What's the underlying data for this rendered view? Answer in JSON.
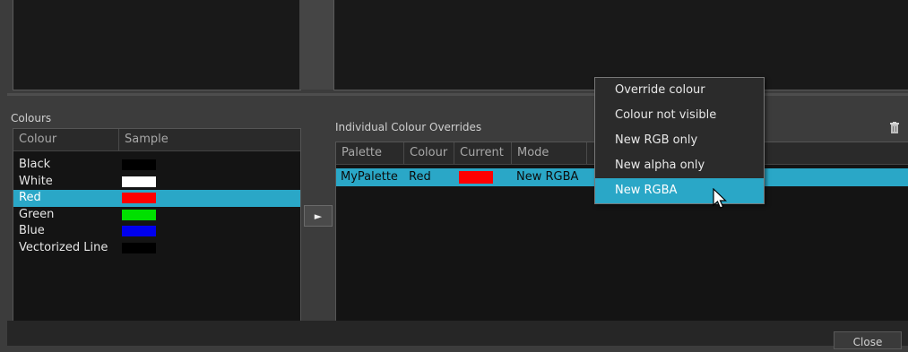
{
  "colours_panel": {
    "label": "Colours",
    "columns": [
      "Colour",
      "Sample"
    ],
    "rows": [
      {
        "name": "Black",
        "sample": "#000000",
        "selected": false
      },
      {
        "name": "White",
        "sample": "#ffffff",
        "selected": false
      },
      {
        "name": "Red",
        "sample": "#ff0000",
        "selected": true
      },
      {
        "name": "Green",
        "sample": "#00e000",
        "selected": false
      },
      {
        "name": "Blue",
        "sample": "#0000ee",
        "selected": false
      },
      {
        "name": "Vectorized Line",
        "sample": "#000000",
        "selected": false
      }
    ]
  },
  "apply_arrow": {
    "glyph": "►",
    "icon": "right-arrow-icon"
  },
  "overrides_panel": {
    "label": "Individual Colour Overrides",
    "columns": [
      "Palette",
      "Colour",
      "Current",
      "Mode"
    ],
    "rows": [
      {
        "palette": "MyPalette",
        "colour": "Red",
        "current": "#ff0000",
        "mode": "New RGBA"
      }
    ],
    "delete_icon": "trash-icon"
  },
  "mode_menu": {
    "items": [
      "Override colour",
      "Colour not visible",
      "New RGB only",
      "New alpha only",
      "New RGBA"
    ],
    "active_index": 4
  },
  "footer": {
    "close_label": "Close"
  },
  "colors": {
    "selection": "#2aa7c7",
    "panel": "#141414",
    "background": "#3c3c3c"
  }
}
